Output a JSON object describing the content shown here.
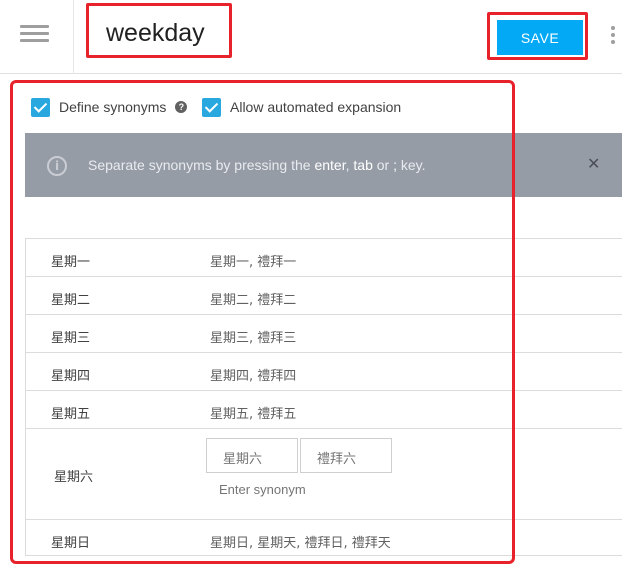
{
  "header": {
    "entity_name": "weekday",
    "save_label": "SAVE",
    "accent_color": "#03a9f4",
    "highlight_color": "#e8222b"
  },
  "options": {
    "define_synonyms": {
      "label": "Define synonyms",
      "checked": true
    },
    "allow_expansion": {
      "label": "Allow automated expansion",
      "checked": true
    }
  },
  "banner": {
    "text_before": "Separate synonyms by pressing the ",
    "key_enter": "enter",
    "sep1": ", ",
    "key_tab": "tab",
    "sep2": " or ",
    "key_semicolon": ";",
    "text_after": " key."
  },
  "entries": [
    {
      "value": "星期一",
      "synonyms": "星期一, 禮拜一"
    },
    {
      "value": "星期二",
      "synonyms": "星期二, 禮拜二"
    },
    {
      "value": "星期三",
      "synonyms": "星期三, 禮拜三"
    },
    {
      "value": "星期四",
      "synonyms": "星期四, 禮拜四"
    },
    {
      "value": "星期五",
      "synonyms": "星期五, 禮拜五"
    },
    {
      "value": "星期六",
      "chips": [
        "星期六",
        "禮拜六"
      ],
      "input_placeholder": "Enter synonym"
    },
    {
      "value": "星期日",
      "synonyms": "星期日, 星期天, 禮拜日, 禮拜天"
    }
  ]
}
